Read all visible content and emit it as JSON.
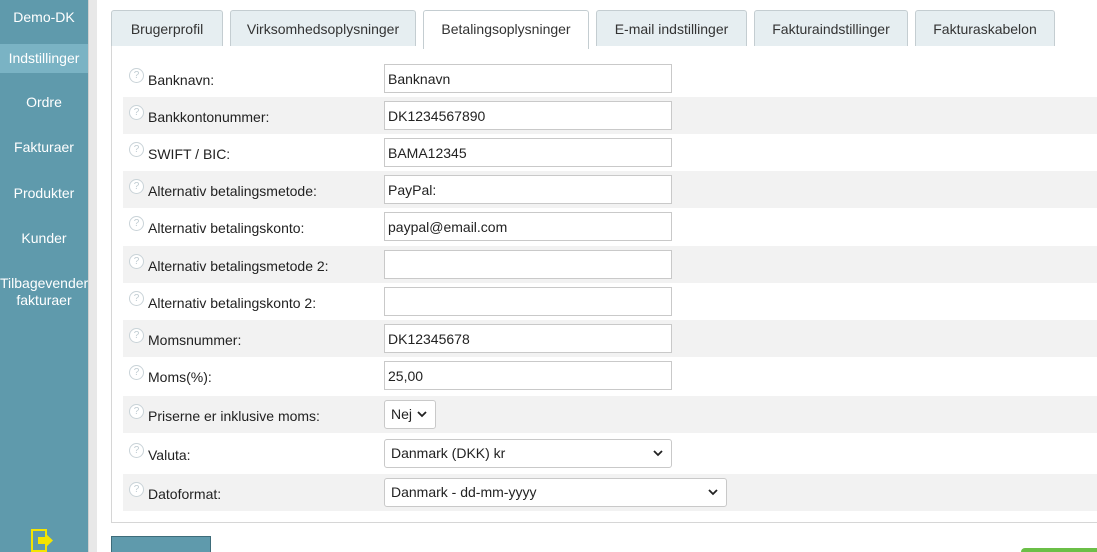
{
  "sidebar": {
    "brand": "Demo-DK",
    "items": [
      {
        "label": "Indstillinger"
      },
      {
        "label": "Ordre"
      },
      {
        "label": "Fakturaer"
      },
      {
        "label": "Produkter"
      },
      {
        "label": "Kunder"
      },
      {
        "label": "Tilbagevender",
        "label2": "fakturaer"
      }
    ],
    "accent": "#5f9aac",
    "active_color": "#7ab3c4",
    "bottom_icon": "logout-icon"
  },
  "tabs": [
    {
      "label": "Brugerprofil",
      "active": false
    },
    {
      "label": "Virksomhedsoplysninger",
      "active": false
    },
    {
      "label": "Betalingsoplysninger",
      "active": true
    },
    {
      "label": "E-mail indstillinger",
      "active": false
    },
    {
      "label": "Fakturaindstillinger",
      "active": false
    },
    {
      "label": "Fakturaskabelon",
      "active": false
    }
  ],
  "form": {
    "help_icon": "help-icon",
    "rows": [
      {
        "label": "Banknavn:",
        "value": "Banknavn"
      },
      {
        "label": "Bankkontonummer:",
        "value": "DK1234567890"
      },
      {
        "label": "SWIFT / BIC:",
        "value": "BAMA12345"
      },
      {
        "label": "Alternativ betalingsmetode:",
        "value": "PayPal:"
      },
      {
        "label": "Alternativ betalingskonto:",
        "value": "paypal@email.com"
      },
      {
        "label": "Alternativ betalingsmetode 2:",
        "value": ""
      },
      {
        "label": "Alternativ betalingskonto 2:",
        "value": ""
      },
      {
        "label": "Momsnummer:",
        "value": "DK12345678"
      },
      {
        "label": "Moms(%):",
        "value": "25,00"
      },
      {
        "label": "Priserne er inklusive moms:",
        "value": "Nej"
      },
      {
        "label": "Valuta:",
        "value": "Danmark (DKK) kr"
      },
      {
        "label": "Datoformat:",
        "value": "Danmark - dd-mm-yyyy"
      }
    ]
  }
}
